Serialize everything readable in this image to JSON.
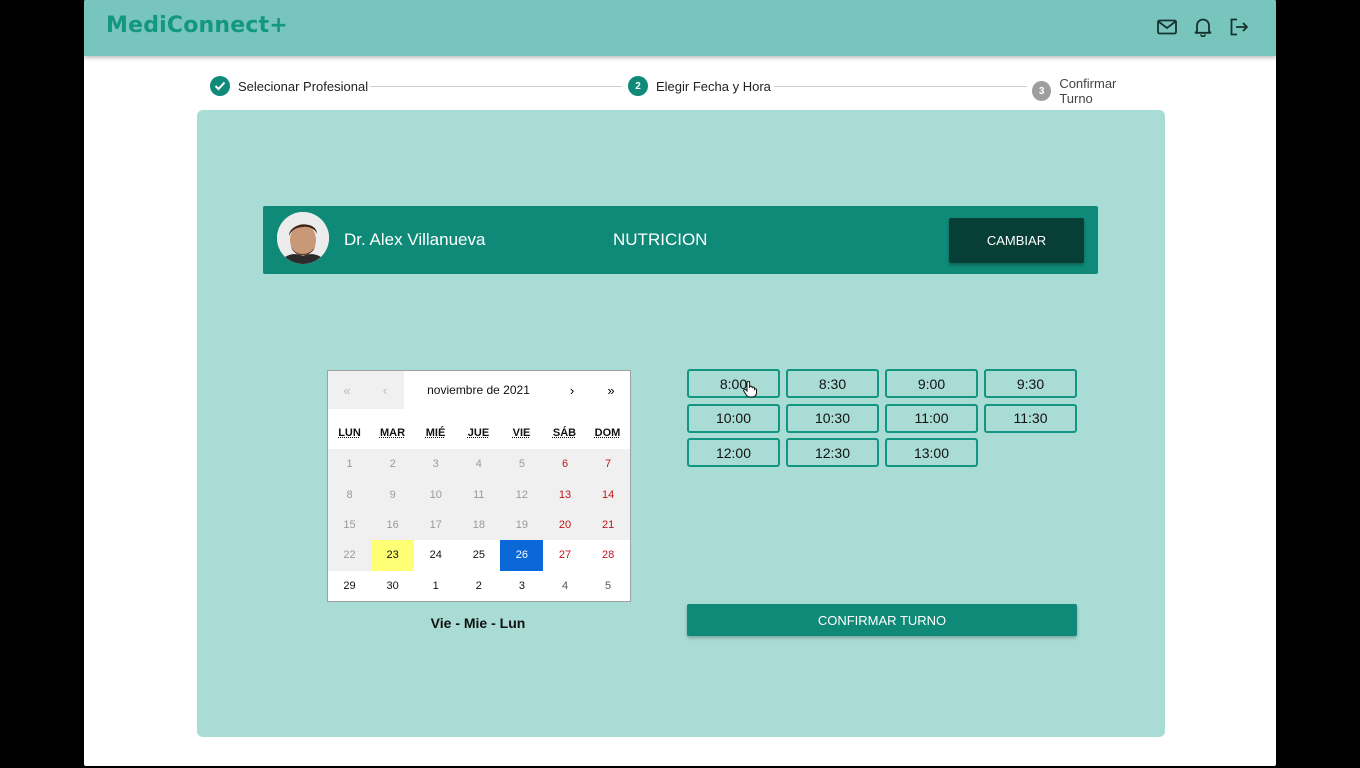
{
  "app": {
    "logo": "MediConnect+"
  },
  "header_icons": [
    "mail-icon",
    "bell-icon",
    "logout-icon"
  ],
  "stepper": {
    "steps": [
      {
        "label": "Selecionar Profesional",
        "state": "done",
        "number": ""
      },
      {
        "label": "Elegir Fecha y Hora",
        "state": "active",
        "number": "2"
      },
      {
        "label": "Confirmar Turno",
        "state": "pending",
        "number": "3"
      }
    ]
  },
  "doctor": {
    "name": "Dr. Alex Villanueva",
    "specialty": "NUTRICION",
    "change_label": "CAMBIAR"
  },
  "calendar": {
    "nav_prev2": "«",
    "nav_prev": "‹",
    "nav_next": "›",
    "nav_next2": "»",
    "month_label": "noviembre de 2021",
    "weekdays": [
      "LUN",
      "MAR",
      "MIÉ",
      "JUE",
      "VIE",
      "SÁB",
      "DOM"
    ],
    "weeks": [
      [
        "1",
        "2",
        "3",
        "4",
        "5",
        "6",
        "7"
      ],
      [
        "8",
        "9",
        "10",
        "11",
        "12",
        "13",
        "14"
      ],
      [
        "15",
        "16",
        "17",
        "18",
        "19",
        "20",
        "21"
      ],
      [
        "22",
        "23",
        "24",
        "25",
        "26",
        "27",
        "28"
      ],
      [
        "29",
        "30",
        "1",
        "2",
        "3",
        "4",
        "5"
      ]
    ],
    "today": "23",
    "selected": "26",
    "available_days_note": "Vie - Mie - Lun"
  },
  "time_slots": [
    "8:00",
    "8:30",
    "9:00",
    "9:30",
    "10:00",
    "10:30",
    "11:00",
    "11:30",
    "12:00",
    "12:30",
    "13:00"
  ],
  "confirm_label": "CONFIRMAR TURNO",
  "colors": {
    "header_bg": "#77c5bc",
    "logo": "#14977f",
    "panel_bg": "#a8dcd5",
    "accent": "#0f8a78",
    "dark_button": "#073f37",
    "today_highlight": "#ffff76",
    "selected_day": "#0b68d8",
    "weekend_text": "#c0141c"
  }
}
